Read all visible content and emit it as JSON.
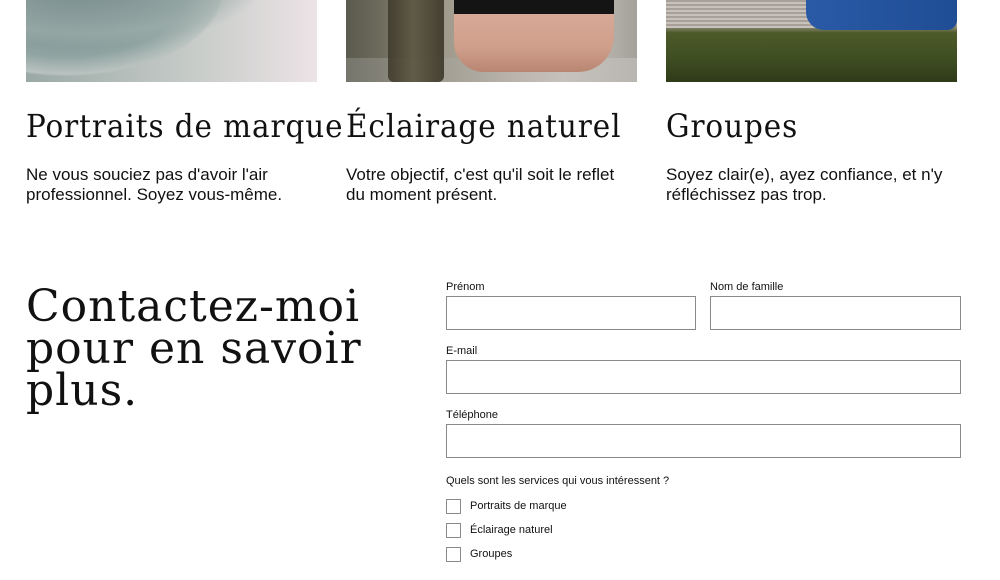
{
  "services": [
    {
      "title": "Portraits de marque",
      "description": "Ne vous souciez pas d'avoir l'air professionnel. Soyez vous-même."
    },
    {
      "title": "Éclairage naturel",
      "description": "Votre objectif, c'est qu'il soit le reflet du moment présent."
    },
    {
      "title": "Groupes",
      "description": "Soyez clair(e), ayez confiance, et n'y réfléchissez pas trop."
    }
  ],
  "contact": {
    "heading": "Contactez-moi pour en savoir plus."
  },
  "form": {
    "first_name_label": "Prénom",
    "first_name_value": "",
    "last_name_label": "Nom de famille",
    "last_name_value": "",
    "email_label": "E-mail",
    "email_value": "",
    "phone_label": "Téléphone",
    "phone_value": "",
    "services_question": "Quels sont les services qui vous intéressent ?",
    "service_options": [
      {
        "label": "Portraits de marque",
        "checked": false
      },
      {
        "label": "Éclairage naturel",
        "checked": false
      },
      {
        "label": "Groupes",
        "checked": false
      }
    ]
  }
}
